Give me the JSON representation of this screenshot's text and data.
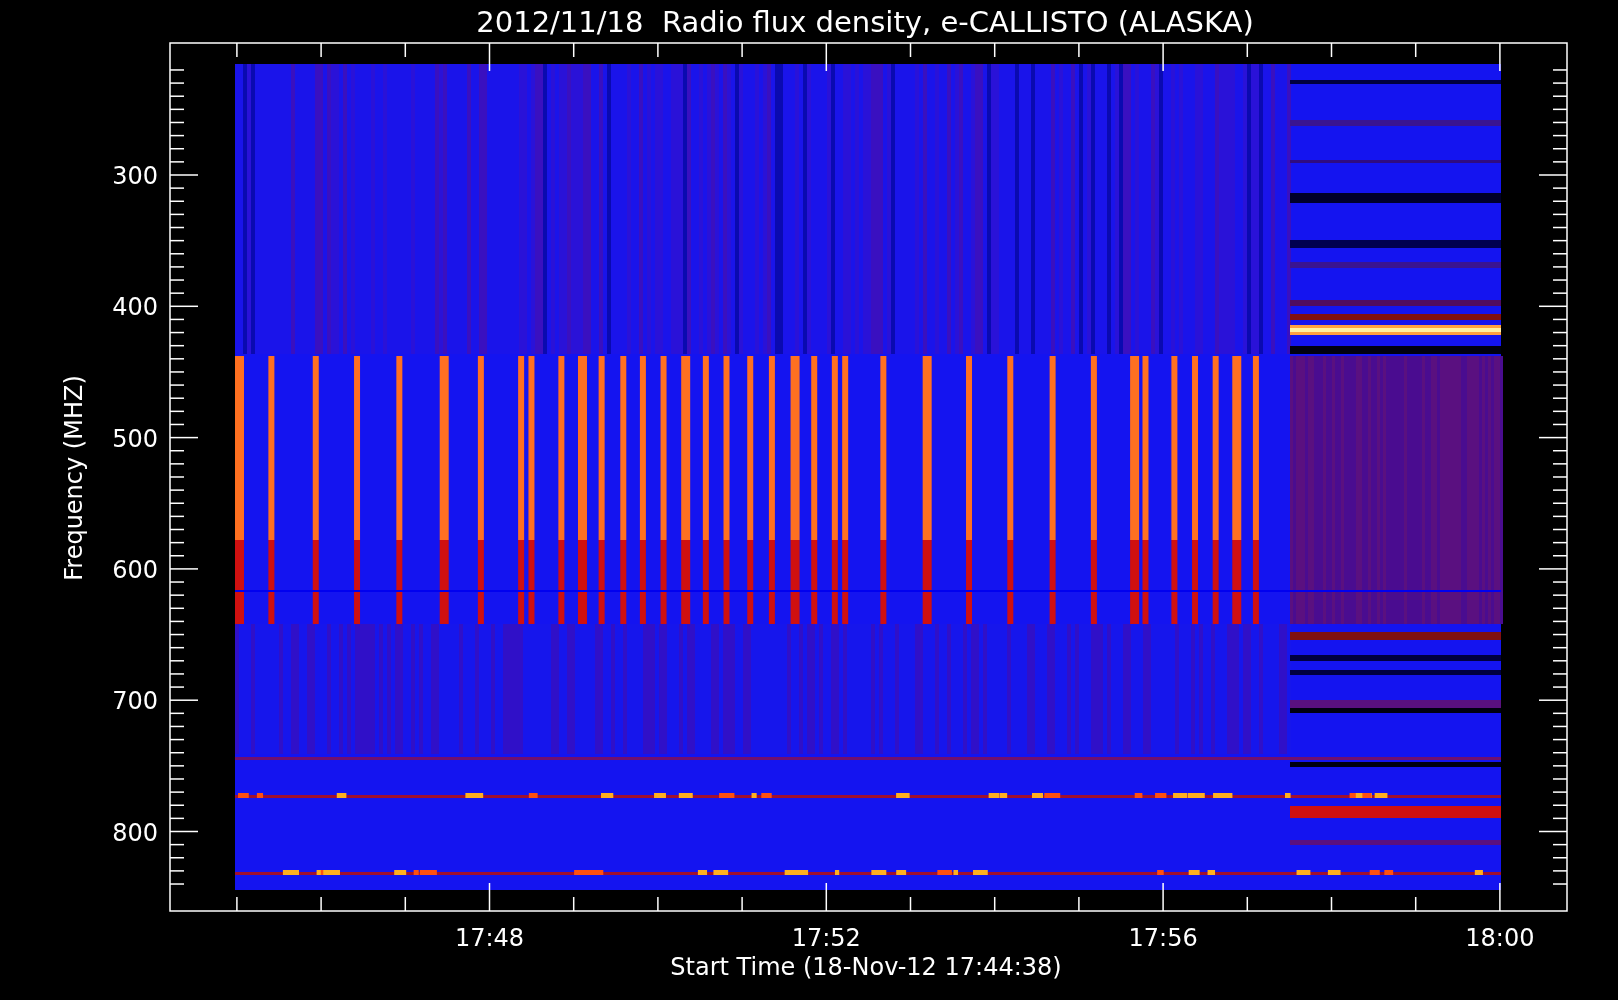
{
  "title": "2012/11/18  Radio flux density, e-CALLISTO (ALASKA)",
  "y_axis": {
    "label": "Frequency (MHZ)",
    "ticks": [
      "300",
      "400",
      "500",
      "600",
      "700",
      "800"
    ]
  },
  "x_axis": {
    "label": "Start Time (18-Nov-12 17:44:38)",
    "ticks": [
      "17:48",
      "17:52",
      "17:56",
      "18:00"
    ]
  }
}
